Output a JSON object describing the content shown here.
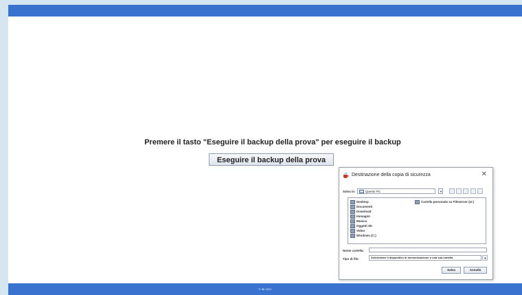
{
  "page": {
    "instruction": "Premere il tasto \"Eseguire il backup della prova\" per eseguire il backup",
    "backup_button": "Eseguire il backup della prova",
    "footer": "© IBI 2021"
  },
  "dialog": {
    "title": "Destinazione della copia di sicurezza",
    "save_in_label": "Salva in:",
    "save_in_value": "Questo PC",
    "folder_name_label": "Nome cartella:",
    "folder_name_value": "",
    "file_type_label": "Tipo di file:",
    "file_type_value": "Selezionare il dispositivo di memorizzazione o una sua cartella",
    "save_button": "Salva",
    "cancel_button": "Annulla",
    "items_left": [
      "Desktop",
      "Documenti",
      "Download",
      "Immagini",
      "Musica",
      "Oggetti 3D",
      "Video",
      "Windows (C:)"
    ],
    "items_right": [
      "Cartella personale su Fileserver (U:)"
    ]
  },
  "colors": {
    "bar": "#3a72cf",
    "background": "#d6e6f1"
  },
  "icons": [
    "java-cup-icon",
    "close-icon",
    "folder-icon",
    "drive-icon",
    "chevron-down-icon"
  ]
}
